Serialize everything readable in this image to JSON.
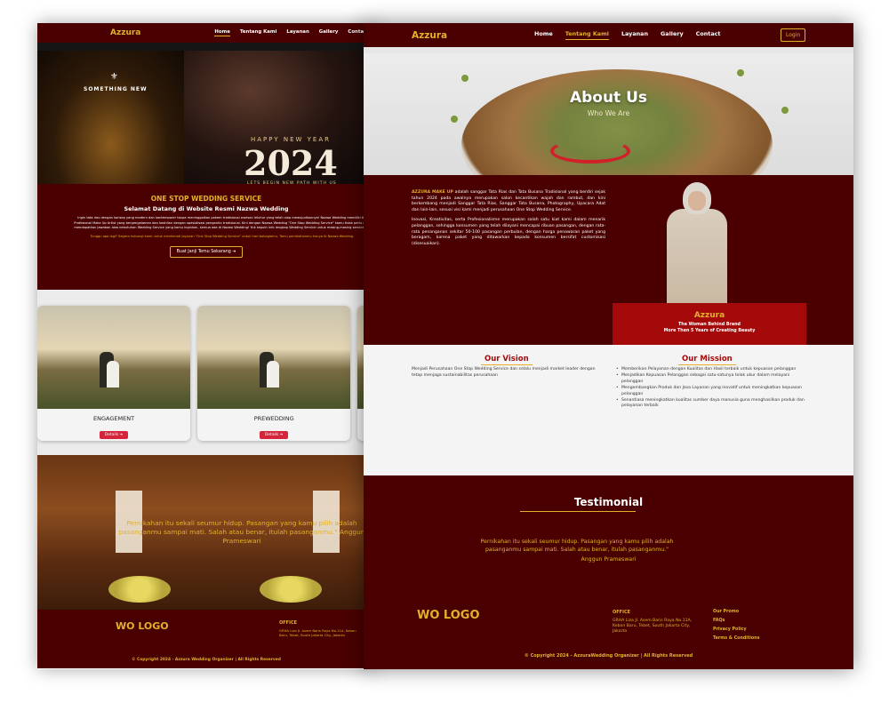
{
  "back": {
    "brand": "Azzura",
    "nav": [
      "Home",
      "Tentang Kami",
      "Layanan",
      "Gallery",
      "Contact"
    ],
    "hero": {
      "tag": "SOMETHING NEW",
      "greeting": "HAPPY NEW YEAR",
      "year": "2024",
      "tagline": "LETS BEGIN NEW PATH WITH US"
    },
    "intro": {
      "title": "ONE STOP WEDDING SERVICE",
      "subtitle": "Selamat Datang di Website Resmi Nazwa Wedding",
      "body": "Ingin tata rias dengan konsep yang modern dan kontemporer tanpa meninggalkan pakem tradisional warisan leluhur yang telah siap mewujudkannya! Nazwa Wedding memiliki tim Profesional Make Up Artist yang berpengalaman dan keahlian dengan spesialisasi pengantin tradisional. Kini dengan Nazwa Wedding \"One Stop Wedding Service\" kamu tidak perlu ribet mendapatkan jawaban atas kebutuhan Wedding Service yang kamu inginkan, semua ada di Nazwa Wedding! Yuk kepoin info lengkap Wedding Service untuk masing-masing servicemu!",
      "cta_text": "Tunggu apa lagi? Segera hubungi kami untuk menikmati layanan \"One Stop Wedding Service\" untuk hari bahagiamu. Tamu pernikahanmu hanya di Nazwa Wedding.",
      "button": "Buat Janji Temu Sekarang ➔"
    },
    "cards": [
      {
        "title": "ENGAGEMENT",
        "button": "Details ➔"
      },
      {
        "title": "PREWEDDING",
        "button": "Details ➔"
      }
    ],
    "quote": "Pernikahan itu sekali seumur hidup. Pasangan yang kamu pilih adalah pasanganmu sampai mati. Salah atau benar, itulah pasanganmu.\" Anggun Prameswari",
    "footer": {
      "logo": "WO LOGO",
      "office_label": "OFFICE",
      "address": "GRHA Liza Jl. Asem Baris Raya No.11A, Kebon Baru, Tebet, South Jakarta City, Jakarta",
      "copyright": "© Copyright 2024 - Azzura Wedding Organizer | All Rights Reserved"
    }
  },
  "front": {
    "brand": "Azzura",
    "nav": [
      "Home",
      "Tentang Kami",
      "Layanan",
      "Gallery",
      "Contact"
    ],
    "active_nav": "Tentang Kami",
    "login": "Login",
    "hero": {
      "title": "About Us",
      "subtitle": "Who We Are"
    },
    "about": {
      "brand_lead": "AZZURA MAKE UP",
      "para1": " adalah sanggar Tata Rias dan Tata Busana Tradisional yang berdiri sejak tahun 2024 pada awalnya merupakan salon kecantikan wajah dan rambut, dan kini berkembang menjadi Sanggar Tata Rias, Sanggar Tata Busana, Photography, Upacara Adat dan lain-lain, sesuai visi kami menjadi perusahaan One Stop Wedding Service.",
      "para2": "Inovasi, Kreativitas, serta Profesionalisme merupakan salah satu kiat kami dalam menarik pelanggan, sehingga konsumen yang telah dilayani mencapai ribuan pasangan, dengan rata-rata penanganan sekitar 50-100 pasangan perbulan, dengan harga penawaran paket yang beragam, karena paket yang ditawarkan kepada konsumen bersifat customisasi (disesuaikan)."
    },
    "founder": {
      "name": "Azzura",
      "line1": "The Woman Behind Brand",
      "line2": "More Then 5 Years of Creating Beauty"
    },
    "vision": {
      "title": "Our Vision",
      "text": "Menjadi Perusahaan One Stop Wedding Service dan selalu menjadi market leader dengan tetap menjaga sustainabilitas perusahaan"
    },
    "mission": {
      "title": "Our Mission",
      "items": [
        "Memberikan Pelayanan dengan Kualitas dan Hasil terbaik untuk kepuasan pelanggan",
        "Menjadikan Kepuasan Pelanggan sebagai satu-satunya tolak ukur dalam melayani pelanggan",
        "Mengembangkan Produk dan Jasa Layanan yang inovatif untuk meningkatkan kepuasan pelanggan",
        "Senantiasa meningkatkan kualitas sumber daya manusia guna menghasilkan produk dan pelayanan terbaik"
      ]
    },
    "testimonial": {
      "title": "Testimonial",
      "quote": "Pernikahan itu sekali seumur hidup. Pasangan yang kamu pilih adalah pasanganmu sampai mati. Salah atau benar, itulah pasanganmu.\"",
      "author": "Anggun Prameswari"
    },
    "footer": {
      "logo": "WO LOGO",
      "office_label": "OFFICE",
      "address": "GRHA Liza Jl. Asem Baris Raya No.11A, Kebon Baru, Tebet, South Jakarta City, Jakarta",
      "links": [
        "Our Promo",
        "FAQs",
        "Privacy Policy",
        "Terms & Conditions"
      ],
      "copyright": "© Copyright 2024 - AzzuraWedding Organizer | All Rights Reserved"
    }
  },
  "colors": {
    "maroon": "#4a0000",
    "gold": "#e2b12c",
    "red": "#a50a0a",
    "button_red": "#d6243a"
  }
}
